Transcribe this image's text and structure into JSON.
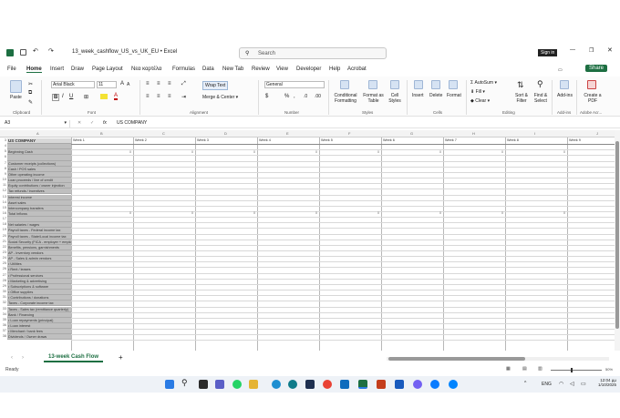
{
  "titlebar": {
    "filename": "13_week_cashflow_US_vs_UK_EU",
    "app": "Excel",
    "search_placeholder": "Search",
    "sign_in": "Sign in",
    "undo_icon": "undo-icon",
    "save_icon": "save-icon"
  },
  "menu": [
    "File",
    "Home",
    "Insert",
    "Draw",
    "Page Layout",
    "Νεα καρτέλα",
    "Formulas",
    "Data",
    "New Tab",
    "Review",
    "View",
    "Developer",
    "Help",
    "Acrobat"
  ],
  "share": "Share",
  "ribbon": {
    "paste": "Paste",
    "font_name": "Arial Black",
    "font_size": "11",
    "wrap_text": "Wrap Text",
    "merge_center": "Merge & Center",
    "number_format": "General",
    "conditional": "Conditional Formatting",
    "format_table": "Format as Table",
    "cell_styles": "Cell Styles",
    "insert": "Insert",
    "delete": "Delete",
    "format": "Format",
    "autosum": "AutoSum",
    "fill": "Fill",
    "clear": "Clear",
    "sort_filter": "Sort & Filter",
    "find_select": "Find & Select",
    "addins": "Add-ins",
    "create_pdf": "Create a PDF",
    "groups": {
      "clipboard": "Clipboard",
      "font": "Font",
      "alignment": "Alignment",
      "number": "Number",
      "styles": "Styles",
      "cells": "Cells",
      "editing": "Editing",
      "addins": "Add-ins",
      "adobe": "Adobe Acr..."
    }
  },
  "formula": {
    "name_box": "A3",
    "fx": "fx",
    "content": "US COMPANY"
  },
  "columns": [
    "A",
    "B",
    "C",
    "D",
    "E",
    "F",
    "G",
    "H",
    "I",
    "J"
  ],
  "header_row": {
    "label": "US COMPANY",
    "weeks": [
      "Week 1",
      "Week 2",
      "Week 3",
      "Week 4",
      "Week 5",
      "Week 6",
      "Week 7",
      "Week 8",
      "Week 9"
    ]
  },
  "rows": [
    {
      "n": "3",
      "label": "US COMPANY"
    },
    {
      "n": "4",
      "label": ""
    },
    {
      "n": "5",
      "label": "Beginning Cash"
    },
    {
      "n": "6",
      "label": ""
    },
    {
      "n": "7",
      "label": "Customer receipts (collections)"
    },
    {
      "n": "8",
      "label": "Cash / POS sales"
    },
    {
      "n": "9",
      "label": "Other operating income"
    },
    {
      "n": "10",
      "label": "Loan proceeds / line of credit"
    },
    {
      "n": "11",
      "label": "Equity contributions / owner injection"
    },
    {
      "n": "12",
      "label": "Tax refunds / incentives"
    },
    {
      "n": "13",
      "label": "Interest income"
    },
    {
      "n": "14",
      "label": "Asset sales"
    },
    {
      "n": "15",
      "label": "Intercompany transfers"
    },
    {
      "n": "16",
      "label": "Total Inflows"
    },
    {
      "n": "17",
      "label": ""
    },
    {
      "n": "18",
      "label": "Net salaries / wages"
    },
    {
      "n": "19",
      "label": "Payroll taxes - Federal income tax"
    },
    {
      "n": "20",
      "label": "Payroll taxes - State/Local income tax"
    },
    {
      "n": "21",
      "label": "Social Security (FICA - employer + employee)"
    },
    {
      "n": "22",
      "label": "Benefits, pensions, garnishments"
    },
    {
      "n": "23",
      "label": "AP - Inventory vendors"
    },
    {
      "n": "24",
      "label": "AP - Sales & admin vendors"
    },
    {
      "n": "25",
      "label": "• Utilities"
    },
    {
      "n": "26",
      "label": "• Rent / leases"
    },
    {
      "n": "27",
      "label": "• Professional services"
    },
    {
      "n": "28",
      "label": "• Marketing & advertising"
    },
    {
      "n": "29",
      "label": "• Subscriptions & software"
    },
    {
      "n": "30",
      "label": "• Office supplies"
    },
    {
      "n": "31",
      "label": "• Contributions / donations"
    },
    {
      "n": "32",
      "label": "Taxes - Corporate income tax"
    },
    {
      "n": "33",
      "label": "Taxes - Sales tax (remittance quarterly)"
    },
    {
      "n": "34",
      "label": "Bank / Financing"
    },
    {
      "n": "35",
      "label": "• Loan repayments (principal)"
    },
    {
      "n": "36",
      "label": "• Loan interest"
    },
    {
      "n": "37",
      "label": "• Merchant / bank fees"
    },
    {
      "n": "38",
      "label": "Dividends / Owner draws"
    }
  ],
  "zero": "0",
  "sheet_tab": "13-week Cash Flow",
  "status": {
    "ready": "Ready",
    "zoom": "50%"
  },
  "taskbar": {
    "lang": "ENG",
    "time": "12:04 μμ",
    "date": "1/10/2025"
  }
}
